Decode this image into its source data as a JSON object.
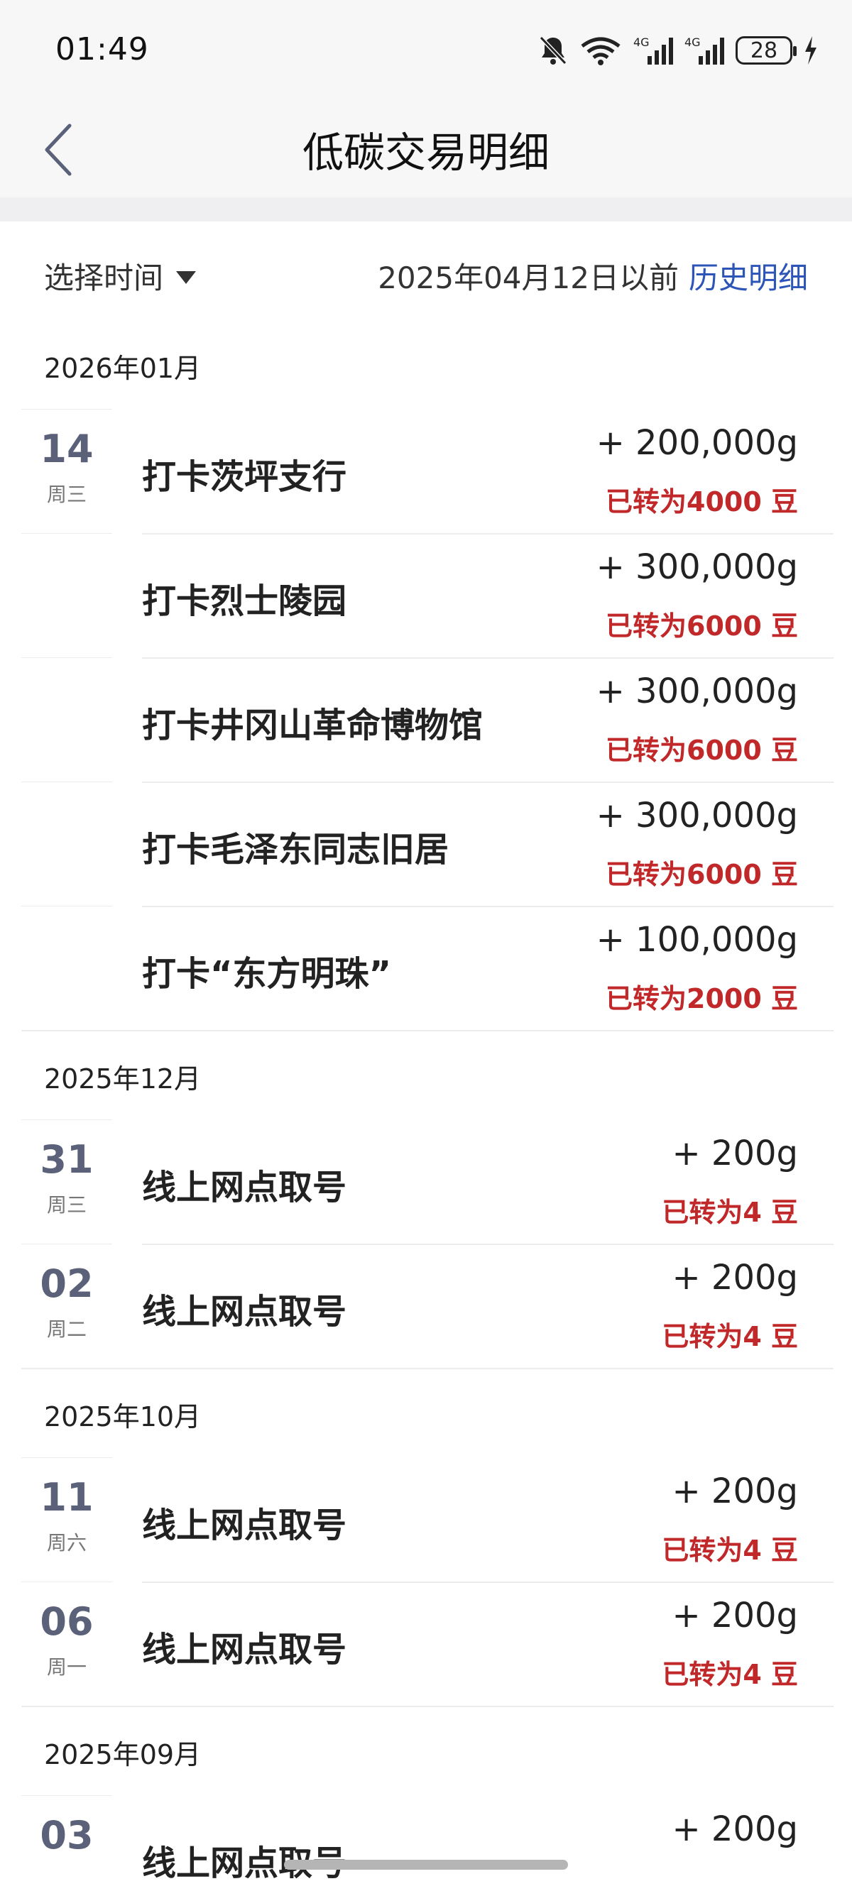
{
  "status_bar": {
    "time": "01:49",
    "battery": "28",
    "icons": [
      "bell-off-icon",
      "wifi-icon",
      "signal-4g-icon",
      "signal-4g-icon",
      "battery-icon",
      "charging-icon"
    ]
  },
  "header": {
    "title": "低碳交易明细"
  },
  "filter": {
    "select_label": "选择时间",
    "before_text": "2025年04月12日以前",
    "history_link": "历史明细"
  },
  "groups": [
    {
      "month": "2026年01月",
      "rows": [
        {
          "day": "14",
          "weekday": "周三",
          "name": "打卡茨坪支行",
          "amount": "+ 200,000g",
          "converted": "已转为4000 豆"
        },
        {
          "day": "",
          "weekday": "",
          "name": "打卡烈士陵园",
          "amount": "+ 300,000g",
          "converted": "已转为6000 豆"
        },
        {
          "day": "",
          "weekday": "",
          "name": "打卡井冈山革命博物馆",
          "amount": "+ 300,000g",
          "converted": "已转为6000 豆"
        },
        {
          "day": "",
          "weekday": "",
          "name": "打卡毛泽东同志旧居",
          "amount": "+ 300,000g",
          "converted": "已转为6000 豆"
        },
        {
          "day": "",
          "weekday": "",
          "name": "打卡“东方明珠”",
          "amount": "+ 100,000g",
          "converted": "已转为2000 豆"
        }
      ]
    },
    {
      "month": "2025年12月",
      "rows": [
        {
          "day": "31",
          "weekday": "周三",
          "name": "线上网点取号",
          "amount": "+ 200g",
          "converted": "已转为4 豆"
        },
        {
          "day": "02",
          "weekday": "周二",
          "name": "线上网点取号",
          "amount": "+ 200g",
          "converted": "已转为4 豆"
        }
      ]
    },
    {
      "month": "2025年10月",
      "rows": [
        {
          "day": "11",
          "weekday": "周六",
          "name": "线上网点取号",
          "amount": "+ 200g",
          "converted": "已转为4 豆"
        },
        {
          "day": "06",
          "weekday": "周一",
          "name": "线上网点取号",
          "amount": "+ 200g",
          "converted": "已转为4 豆"
        }
      ]
    },
    {
      "month": "2025年09月",
      "rows": [
        {
          "day": "03",
          "weekday": "",
          "name": "线上网点取号",
          "amount": "+ 200g",
          "converted": ""
        }
      ]
    }
  ]
}
